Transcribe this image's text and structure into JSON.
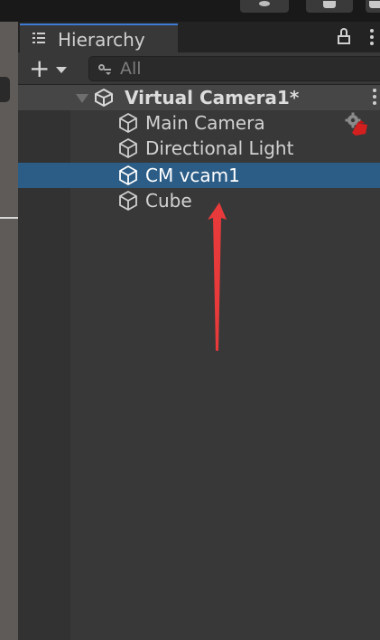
{
  "window": {
    "panel_title": "Hierarchy"
  },
  "icons": {
    "tab": "hierarchy-list-icon",
    "lock": "lock-icon",
    "menu": "kebab-menu-icon",
    "add": "plus-icon",
    "add_dropdown": "caret-down-icon",
    "search": "search-icon",
    "scene": "unity-logo-icon",
    "game_object": "cube-icon",
    "camera_brain": "gear-badge-icon",
    "annotation": "red-arrow"
  },
  "toolbar": {
    "add_label": "+",
    "search": {
      "placeholder": "All",
      "value": ""
    }
  },
  "hierarchy": {
    "scene": {
      "name": "Virtual Camera1*",
      "expanded": true
    },
    "items": [
      {
        "name": "Main Camera",
        "selected": false,
        "badge": "camera-brain"
      },
      {
        "name": "Directional Light",
        "selected": false
      },
      {
        "name": "CM vcam1",
        "selected": true
      },
      {
        "name": "Cube",
        "selected": false
      }
    ]
  },
  "colors": {
    "selection": "#2c5d87",
    "tab_accent": "#3d7bd4",
    "annotation_arrow": "#e83a3a",
    "panel_bg": "#383838"
  }
}
